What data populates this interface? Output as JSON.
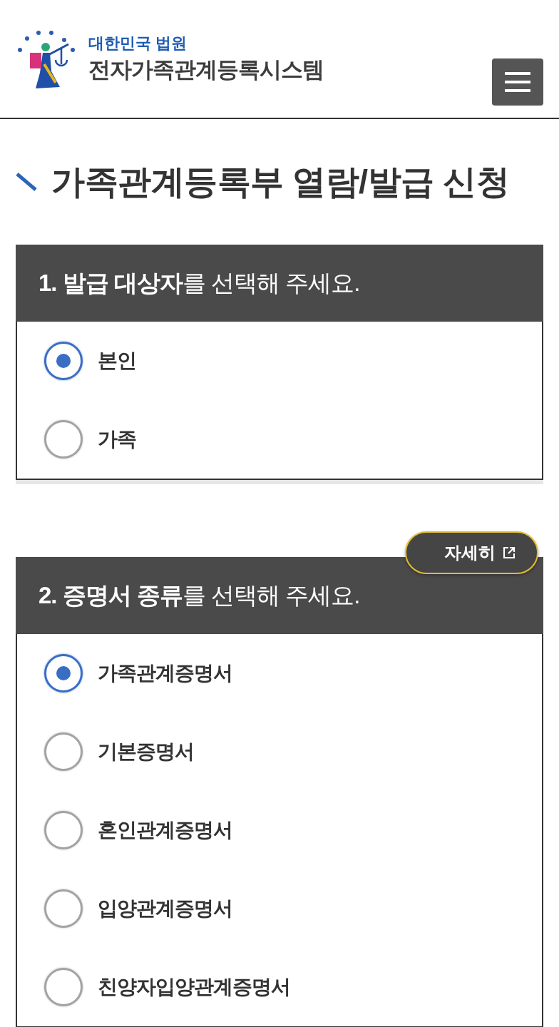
{
  "header": {
    "org": "대한민국 법원",
    "system": "전자가족관계등록시스템"
  },
  "page_title": "가족관계등록부 열람/발급 신청",
  "sections": [
    {
      "title": "**1. 발급 대상자**를 선택해 주세요.",
      "options": [
        {
          "label": "본인",
          "selected": true
        },
        {
          "label": "가족",
          "selected": false
        }
      ]
    },
    {
      "title": "**2. 증명서 종류**를 선택해 주세요.",
      "detail_button": "자세히",
      "options": [
        {
          "label": "가족관계증명서",
          "selected": true
        },
        {
          "label": "기본증명서",
          "selected": false
        },
        {
          "label": "혼인관계증명서",
          "selected": false
        },
        {
          "label": "입양관계증명서",
          "selected": false
        },
        {
          "label": "친양자입양관계증명서",
          "selected": false
        }
      ]
    }
  ]
}
